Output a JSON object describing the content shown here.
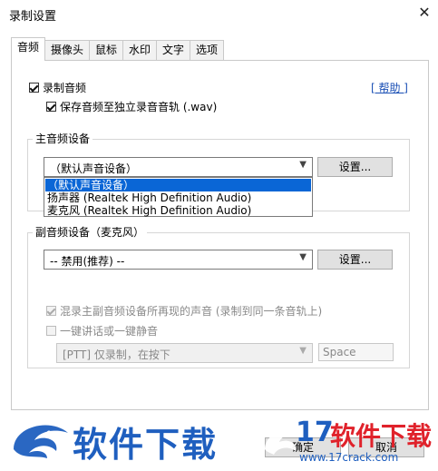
{
  "window": {
    "title": "录制设置",
    "close_glyph": "✕"
  },
  "tabs": [
    "音频",
    "摄像头",
    "鼠标",
    "水印",
    "文字",
    "选项"
  ],
  "audio": {
    "record_audio_label": "录制音频",
    "save_separate_label": "保存音频至独立录音音轨 (.wav)",
    "help_link": "[ 帮助 ]",
    "main_device": {
      "legend": "主音频设备",
      "selected": "（默认声音设备）",
      "settings_button": "设置...",
      "options": [
        "（默认声音设备）",
        "扬声器 (Realtek High Definition Audio)",
        "麦克风 (Realtek High Definition Audio)"
      ]
    },
    "secondary_device": {
      "legend": "副音频设备（麦克风）",
      "selected": "-- 禁用(推荐) --",
      "settings_button": "设置...",
      "mix_label": "混录主副音频设备所再现的声音 (录制到同一条音轨上)",
      "ptt_label": "一键讲话或一键静音",
      "ptt_mode": "[PTT] 仅录制，在按下",
      "ptt_key": "Space"
    }
  },
  "footer": {
    "ok_button": "确定",
    "cancel_button": "取消"
  },
  "watermark": {
    "left_text": "软件下载",
    "right_number": "17",
    "right_text": "软件下载",
    "url": "www.17crack.com"
  },
  "colors": {
    "accent": "#0a66d6",
    "link": "#1a4fb5",
    "watermark_blue": "#1f5fbf",
    "watermark_red": "#e0222b"
  }
}
